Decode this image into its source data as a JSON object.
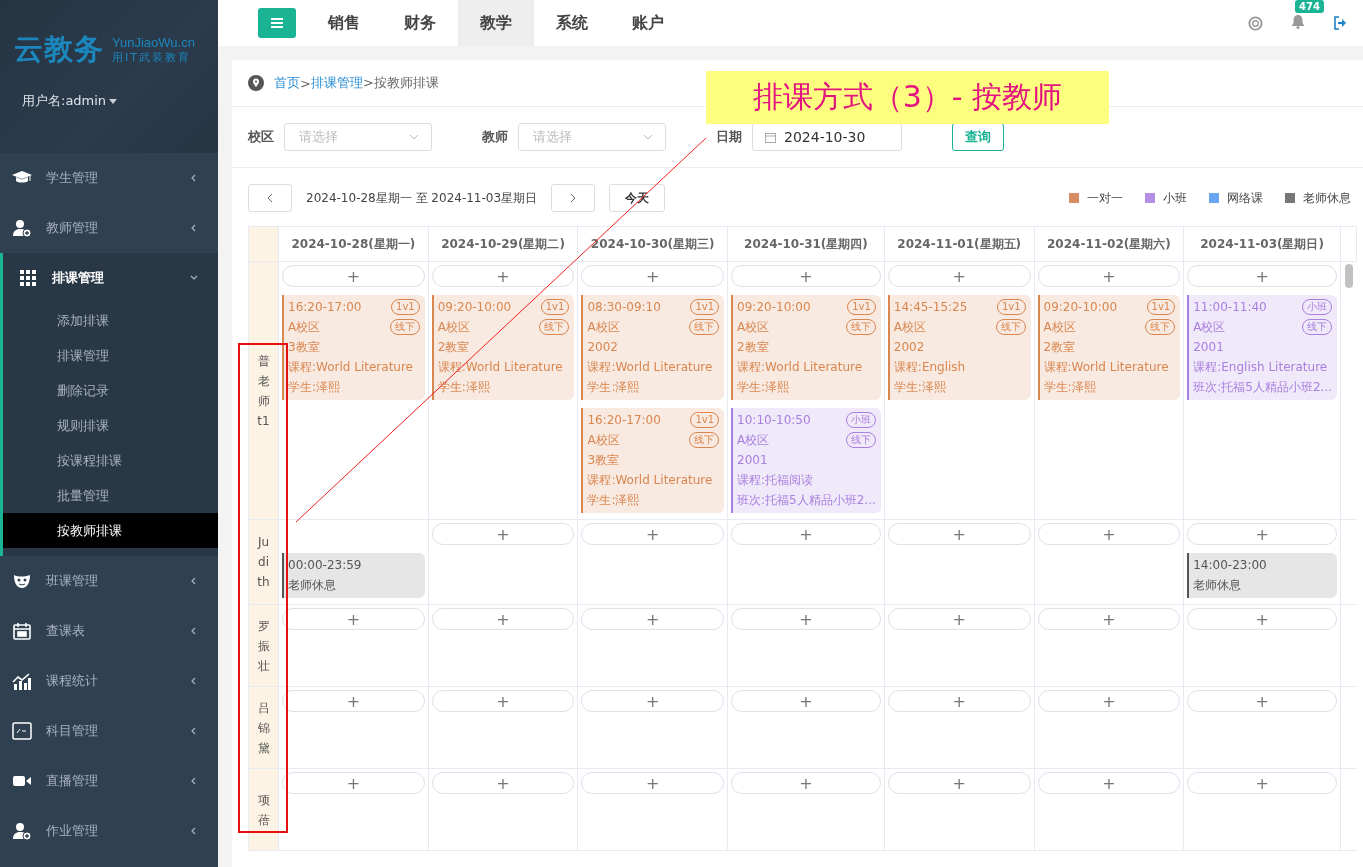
{
  "sidebar": {
    "logo": "云教务",
    "logo_domain": "YunJiaoWu.cn",
    "logo_slogan": "用IT武装教育",
    "user": "用户名:admin",
    "menu": [
      {
        "label": "学生管理",
        "expanded": false
      },
      {
        "label": "教师管理",
        "expanded": false
      },
      {
        "label": "排课管理",
        "expanded": true,
        "children": [
          {
            "label": "添加排课",
            "selected": false
          },
          {
            "label": "排课管理",
            "selected": false
          },
          {
            "label": "删除记录",
            "selected": false
          },
          {
            "label": "规则排课",
            "selected": false
          },
          {
            "label": "按课程排课",
            "selected": false
          },
          {
            "label": "批量管理",
            "selected": false
          },
          {
            "label": "按教师排课",
            "selected": true
          }
        ]
      },
      {
        "label": "班课管理",
        "expanded": false
      },
      {
        "label": "查课表",
        "expanded": false
      },
      {
        "label": "课程统计",
        "expanded": false
      },
      {
        "label": "科目管理",
        "expanded": false
      },
      {
        "label": "直播管理",
        "expanded": false
      },
      {
        "label": "作业管理",
        "expanded": false
      }
    ]
  },
  "top_tabs": [
    {
      "label": "销售",
      "selected": false
    },
    {
      "label": "财务",
      "selected": false
    },
    {
      "label": "教学",
      "selected": true
    },
    {
      "label": "系统",
      "selected": false
    },
    {
      "label": "账户",
      "selected": false
    }
  ],
  "notification_count": "474",
  "breadcrumb": [
    {
      "text": "首页",
      "link": true
    },
    {
      "text": ">",
      "link": false
    },
    {
      "text": "排课管理",
      "link": true
    },
    {
      "text": ">按教师排课",
      "link": false
    }
  ],
  "filters": {
    "campus": {
      "label": "校区",
      "placeholder": "请选择"
    },
    "teacher": {
      "label": "教师",
      "placeholder": "请选择"
    },
    "date": {
      "label": "日期",
      "value": "2024-10-30"
    },
    "query_button": "查询"
  },
  "week": {
    "range": "2024-10-28星期一 至 2024-11-03星期日",
    "today_button": "今天"
  },
  "legend": [
    {
      "label": "一对一",
      "color": "#d98b64"
    },
    {
      "label": "小班",
      "color": "#b58fe3"
    },
    {
      "label": "网络课",
      "color": "#6aa6ef"
    },
    {
      "label": "老师休息",
      "color": "#777777"
    }
  ],
  "days": [
    "2024-10-28(星期一)",
    "2024-10-29(星期二)",
    "2024-10-30(星期三)",
    "2024-10-31(星期四)",
    "2024-11-01(星期五)",
    "2024-11-02(星期六)",
    "2024-11-03(星期日)"
  ],
  "teachers": [
    {
      "name": "普老师t1",
      "days": [
        {
          "add": "+",
          "events": [
            {
              "kind": "one_on_one",
              "time": "16:20-17:00",
              "tags": [
                "1v1",
                "线下"
              ],
              "lines": [
                "A校区",
                "3教室",
                "课程:World Literature",
                "学生:泽熙"
              ]
            }
          ]
        },
        {
          "add": "+",
          "events": [
            {
              "kind": "one_on_one",
              "time": "09:20-10:00",
              "tags": [
                "1v1",
                "线下"
              ],
              "lines": [
                "A校区",
                "2教室",
                "课程:World Literature",
                "学生:泽熙"
              ]
            }
          ]
        },
        {
          "add": "+",
          "events": [
            {
              "kind": "one_on_one",
              "time": "08:30-09:10",
              "tags": [
                "1v1",
                "线下"
              ],
              "lines": [
                "A校区",
                "2002",
                "课程:World Literature",
                "学生:泽熙"
              ]
            },
            {
              "kind": "one_on_one",
              "time": "16:20-17:00",
              "tags": [
                "1v1",
                "线下"
              ],
              "lines": [
                "A校区",
                "3教室",
                "课程:World Literature",
                "学生:泽熙"
              ]
            }
          ]
        },
        {
          "add": "+",
          "events": [
            {
              "kind": "one_on_one",
              "time": "09:20-10:00",
              "tags": [
                "1v1",
                "线下"
              ],
              "lines": [
                "A校区",
                "2教室",
                "课程:World Literature",
                "学生:泽熙"
              ]
            },
            {
              "kind": "small_class",
              "time": "10:10-10:50",
              "tags": [
                "小班",
                "线下"
              ],
              "lines": [
                "A校区",
                "2001",
                "课程:托福阅读",
                "班次:托福5人精品小班2..."
              ]
            }
          ]
        },
        {
          "add": "+",
          "events": [
            {
              "kind": "one_on_one",
              "time": "14:45-15:25",
              "tags": [
                "1v1",
                "线下"
              ],
              "lines": [
                "A校区",
                "2002",
                "课程:English",
                "学生:泽熙"
              ]
            }
          ]
        },
        {
          "add": "+",
          "events": [
            {
              "kind": "one_on_one",
              "time": "09:20-10:00",
              "tags": [
                "1v1",
                "线下"
              ],
              "lines": [
                "A校区",
                "2教室",
                "课程:World Literature",
                "学生:泽熙"
              ]
            }
          ]
        },
        {
          "add": "+",
          "events": [
            {
              "kind": "small_class",
              "time": "11:00-11:40",
              "tags": [
                "小班",
                "线下"
              ],
              "lines": [
                "A校区",
                "2001",
                "课程:English Literature",
                "班次:托福5人精品小班2..."
              ]
            }
          ]
        }
      ]
    },
    {
      "name": "Judith",
      "days": [
        {
          "events": [
            {
              "kind": "rest",
              "time": "00:00-23:59",
              "lines": [
                "老师休息"
              ]
            }
          ]
        },
        {
          "add": "+"
        },
        {
          "add": "+"
        },
        {
          "add": "+"
        },
        {
          "add": "+"
        },
        {
          "add": "+"
        },
        {
          "add": "+",
          "events": [
            {
              "kind": "rest",
              "time": "14:00-23:00",
              "lines": [
                "老师休息"
              ]
            }
          ]
        }
      ]
    },
    {
      "name": "罗振壮",
      "days": [
        {
          "add": "+"
        },
        {
          "add": "+"
        },
        {
          "add": "+"
        },
        {
          "add": "+"
        },
        {
          "add": "+"
        },
        {
          "add": "+"
        },
        {
          "add": "+"
        }
      ]
    },
    {
      "name": "吕锦黛",
      "days": [
        {
          "add": "+"
        },
        {
          "add": "+"
        },
        {
          "add": "+"
        },
        {
          "add": "+"
        },
        {
          "add": "+"
        },
        {
          "add": "+"
        },
        {
          "add": "+"
        }
      ]
    },
    {
      "name": "项蓓",
      "days": [
        {
          "add": "+"
        },
        {
          "add": "+"
        },
        {
          "add": "+"
        },
        {
          "add": "+"
        },
        {
          "add": "+"
        },
        {
          "add": "+"
        },
        {
          "add": "+"
        }
      ]
    }
  ],
  "annotation": "排课方式（3）- 按教师"
}
